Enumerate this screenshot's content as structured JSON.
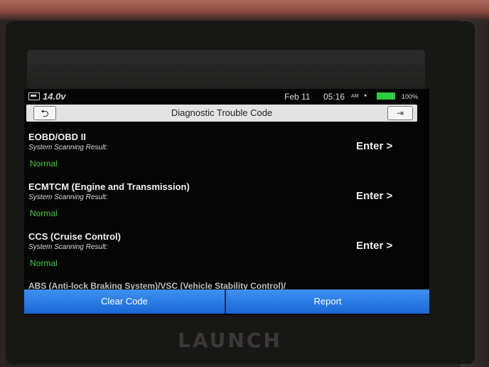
{
  "status": {
    "voltage": "14.0v",
    "date": "Feb 11",
    "time": "05:16",
    "ampm": "AM",
    "battery": "100%"
  },
  "header": {
    "title": "Diagnostic Trouble Code",
    "back_icon": "back-arrow-icon",
    "exit_icon": "exit-icon"
  },
  "systems": [
    {
      "name": "EOBD/OBD II",
      "label": "System Scanning Result:",
      "result": "Normal",
      "action": "Enter >"
    },
    {
      "name": "ECMTCM (Engine and Transmission)",
      "label": "System Scanning Result:",
      "result": "Normal",
      "action": "Enter >"
    },
    {
      "name": "CCS (Cruise Control)",
      "label": "System Scanning Result:",
      "result": "Normal",
      "action": "Enter >"
    }
  ],
  "partial_item": "ABS (Anti-lock Braking System)/VSC (Vehicle Stability Control)/",
  "buttons": {
    "clear": "Clear Code",
    "report": "Report"
  },
  "device_brand": "LAUNCH",
  "colors": {
    "result_normal": "#38d13a",
    "button_blue": "#2a7be4",
    "battery_green": "#2ecc40"
  }
}
